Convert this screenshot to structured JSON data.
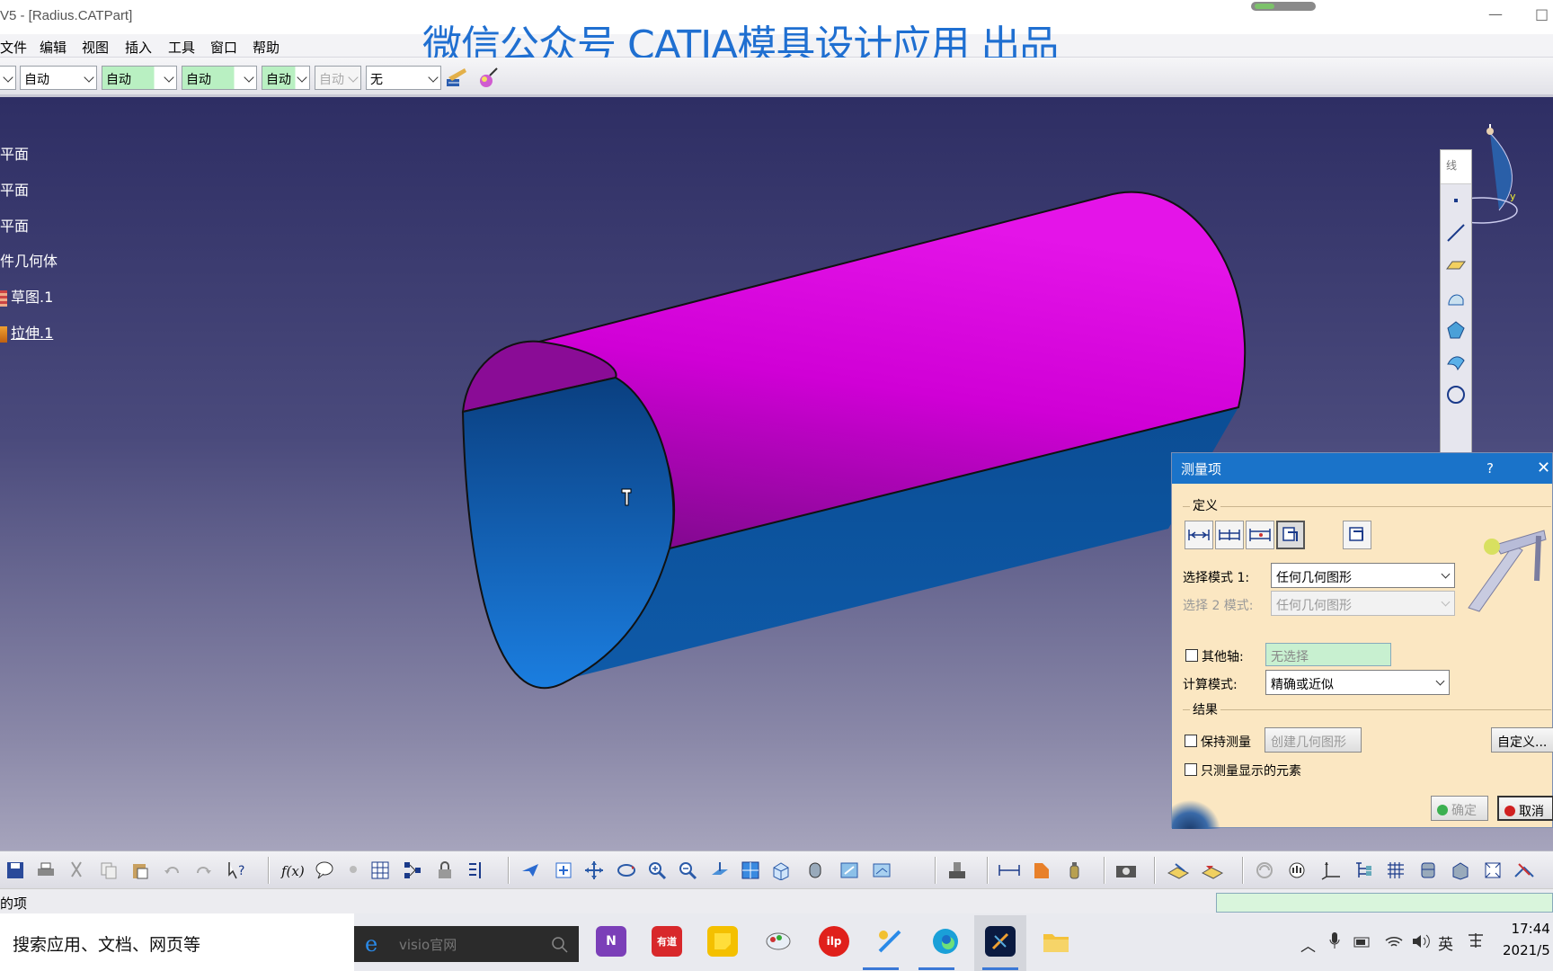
{
  "window": {
    "title": "V5 - [Radius.CATPart]",
    "minimize": "—",
    "maximize": "□"
  },
  "watermark": "微信公众号 CATIA模具设计应用 出品",
  "menu": [
    "文件",
    "编辑",
    "视图",
    "插入",
    "工具",
    "窗口",
    "帮助"
  ],
  "properties_toolbar": {
    "combos": [
      "自动",
      "自动",
      "自动",
      "自动",
      "自动",
      "无"
    ]
  },
  "tree": {
    "items": [
      "平面",
      "平面",
      "平面",
      "件几何体",
      "草图.1",
      "拉伸.1"
    ]
  },
  "measure_dialog": {
    "title": "测量项",
    "help": "?",
    "close": "✕",
    "definition_label": "定义",
    "select_mode_1_label": "选择模式 1:",
    "select_mode_1_value": "任何几何图形",
    "select_mode_2_label": "选择 2 模式:",
    "select_mode_2_value": "任何几何图形",
    "other_axis_label": "其他轴:",
    "other_axis_value": "无选择",
    "calc_mode_label": "计算模式:",
    "calc_mode_value": "精确或近似",
    "results_label": "结果",
    "keep_measure_label": "保持测量",
    "create_geometry_label": "创建几何图形",
    "customize_label": "自定义...",
    "only_displayed_label": "只测量显示的元素",
    "ok_label": "确定",
    "cancel_label": "取消"
  },
  "status": {
    "text": "的项"
  },
  "taskbar": {
    "search_placeholder": "搜索应用、文档、网页等",
    "ie_text": "visio官网",
    "apps": [
      "N",
      "有道",
      "",
      "",
      "ilp",
      "",
      "",
      "",
      ""
    ],
    "ime": "英",
    "clock_time": "17:44",
    "clock_date": "2021/5"
  },
  "colors": {
    "viewport_top": "#2e2e64",
    "cylinder_top": "#e000e0",
    "cylinder_face": "#1060b0",
    "dialog_bg": "#fbe7c2",
    "dialog_title": "#1a73c9"
  }
}
